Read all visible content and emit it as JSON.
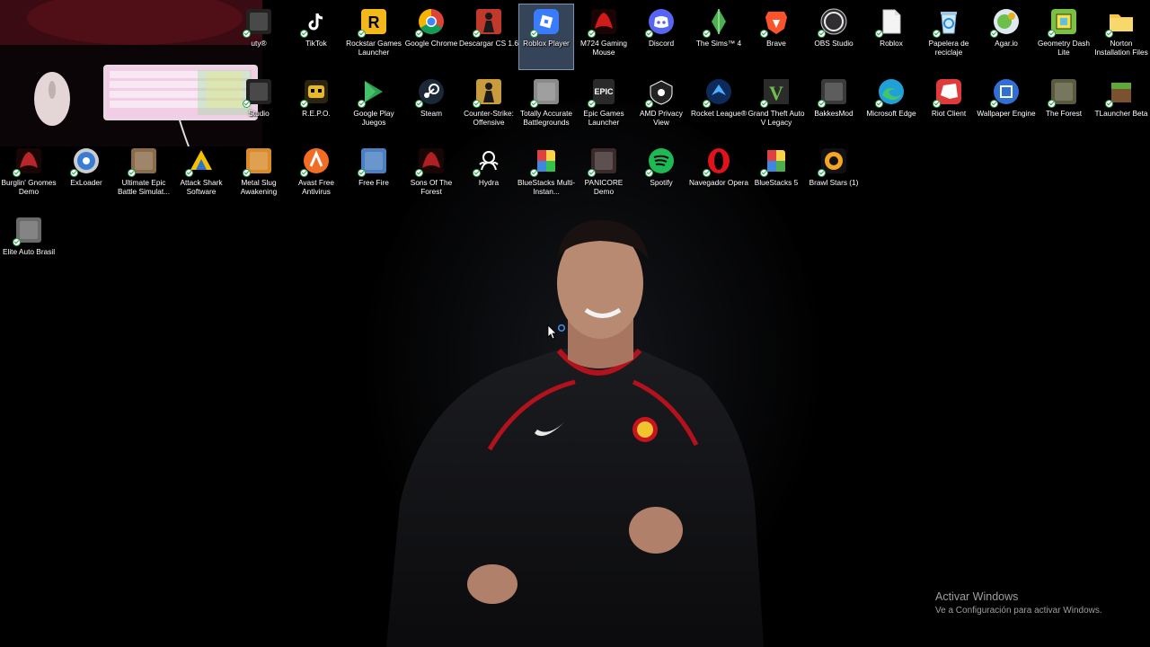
{
  "desktop": {
    "icons": [
      {
        "label": "uty®",
        "icon": "call-of-duty-icon",
        "color": "#222222"
      },
      {
        "label": "TikTok",
        "icon": "tiktok-icon",
        "color": "#000000"
      },
      {
        "label": "Rockstar Games Launcher",
        "icon": "rockstar-icon",
        "color": "#f5b81c"
      },
      {
        "label": "Google Chrome",
        "icon": "chrome-icon",
        "color": "#4285f4"
      },
      {
        "label": "Descargar CS 1.6",
        "icon": "cs16-icon",
        "color": "#c0392b"
      },
      {
        "label": "Roblox Player",
        "icon": "roblox-player-icon",
        "color": "#3a7bfd"
      },
      {
        "label": "M724 Gaming Mouse",
        "icon": "redragon-icon",
        "color": "#d11a1a"
      },
      {
        "label": "Discord",
        "icon": "discord-icon",
        "color": "#5865f2"
      },
      {
        "label": "The Sims™ 4",
        "icon": "sims-icon",
        "color": "#4caf50"
      },
      {
        "label": "Brave",
        "icon": "brave-icon",
        "color": "#fb542b"
      },
      {
        "label": "OBS Studio",
        "icon": "obs-icon",
        "color": "#302e31"
      },
      {
        "label": "Roblox",
        "icon": "file-icon",
        "color": "#f2f2f2"
      },
      {
        "label": "Papelera de reciclaje",
        "icon": "recycle-bin-icon",
        "color": "#7fc4f0"
      },
      {
        "label": "Agar.io",
        "icon": "agario-icon",
        "color": "#6cbf4a"
      },
      {
        "label": "Geometry Dash Lite",
        "icon": "geometry-dash-icon",
        "color": "#7ac142"
      },
      {
        "label": "Norton Installation Files",
        "icon": "folder-icon",
        "color": "#f6c744"
      },
      {
        "label": "Studio",
        "icon": "roblox-studio-icon",
        "color": "#222222"
      },
      {
        "label": "R.E.P.O.",
        "icon": "repo-icon",
        "color": "#e8b923"
      },
      {
        "label": "Google Play Juegos",
        "icon": "google-play-games-icon",
        "color": "#2e9e4f"
      },
      {
        "label": "Steam",
        "icon": "steam-icon",
        "color": "#1b2838"
      },
      {
        "label": "Counter-Strike: Offensive",
        "icon": "csgo-icon",
        "color": "#c89b3c"
      },
      {
        "label": "Totally Accurate Battlegrounds",
        "icon": "tabg-icon",
        "color": "#8a8a8a"
      },
      {
        "label": "Epic Games Launcher",
        "icon": "epic-games-icon",
        "color": "#2a2a2a"
      },
      {
        "label": "AMD Privacy View",
        "icon": "amd-privacy-icon",
        "color": "#111111"
      },
      {
        "label": "Rocket League®",
        "icon": "rocket-league-icon",
        "color": "#1e88e5"
      },
      {
        "label": "Grand Theft Auto V Legacy",
        "icon": "gta-v-icon",
        "color": "#2b2b2b"
      },
      {
        "label": "BakkesMod",
        "icon": "bakkesmod-icon",
        "color": "#3a3a3a"
      },
      {
        "label": "Microsoft Edge",
        "icon": "edge-icon",
        "color": "#1fa0d8"
      },
      {
        "label": "Riot Client",
        "icon": "riot-icon",
        "color": "#e03b3b"
      },
      {
        "label": "Wallpaper Engine",
        "icon": "wallpaper-engine-icon",
        "color": "#2f6fd6"
      },
      {
        "label": "The Forest",
        "icon": "the-forest-icon",
        "color": "#5a5a3e"
      },
      {
        "label": "TLauncher Beta",
        "icon": "tlauncher-icon",
        "color": "#5d8a3a"
      },
      {
        "label": "Burglin' Gnomes Demo",
        "icon": "burglin-gnomes-icon",
        "color": "#b8262b"
      },
      {
        "label": "ExLoader",
        "icon": "exloader-icon",
        "color": "#3a7bd5"
      },
      {
        "label": "Ultimate Epic Battle Simulat...",
        "icon": "uebs-icon",
        "color": "#8a6b4a"
      },
      {
        "label": "Attack Shark Software",
        "icon": "attack-shark-icon",
        "color": "#f2c200"
      },
      {
        "label": "Metal Slug Awakening",
        "icon": "metal-slug-icon",
        "color": "#d98b2b"
      },
      {
        "label": "Avast Free Antivirus",
        "icon": "avast-icon",
        "color": "#f26c22"
      },
      {
        "label": "Free Fire",
        "icon": "free-fire-icon",
        "color": "#4a7fc1"
      },
      {
        "label": "Sons Of The Forest",
        "icon": "sons-forest-icon",
        "color": "#b02020"
      },
      {
        "label": "Hydra",
        "icon": "hydra-icon",
        "color": "#ffffff"
      },
      {
        "label": "BlueStacks Multi-Instan...",
        "icon": "bluestacks-multi-icon",
        "color": "#33c24d"
      },
      {
        "label": "PANICORE Demo",
        "icon": "panicore-icon",
        "color": "#3a2a2a"
      },
      {
        "label": "Spotify",
        "icon": "spotify-icon",
        "color": "#1db954"
      },
      {
        "label": "Navegador Opera",
        "icon": "opera-icon",
        "color": "#e0121a"
      },
      {
        "label": "BlueStacks 5",
        "icon": "bluestacks-icon",
        "color": "#4cae4f"
      },
      {
        "label": "Brawl Stars (1)",
        "icon": "brawl-stars-icon",
        "color": "#f5a623"
      },
      {
        "label": "Elite Auto Brasil",
        "icon": "elite-auto-brasil-icon",
        "color": "#6a6a6a"
      }
    ]
  },
  "cursor_label": "busy-cursor",
  "watermark": {
    "title": "Activar Windows",
    "subtitle": "Ve a Configuración para activar Windows."
  },
  "overlay": {
    "webcam_icon": "webcam-keyboard-mouse-overlay"
  }
}
